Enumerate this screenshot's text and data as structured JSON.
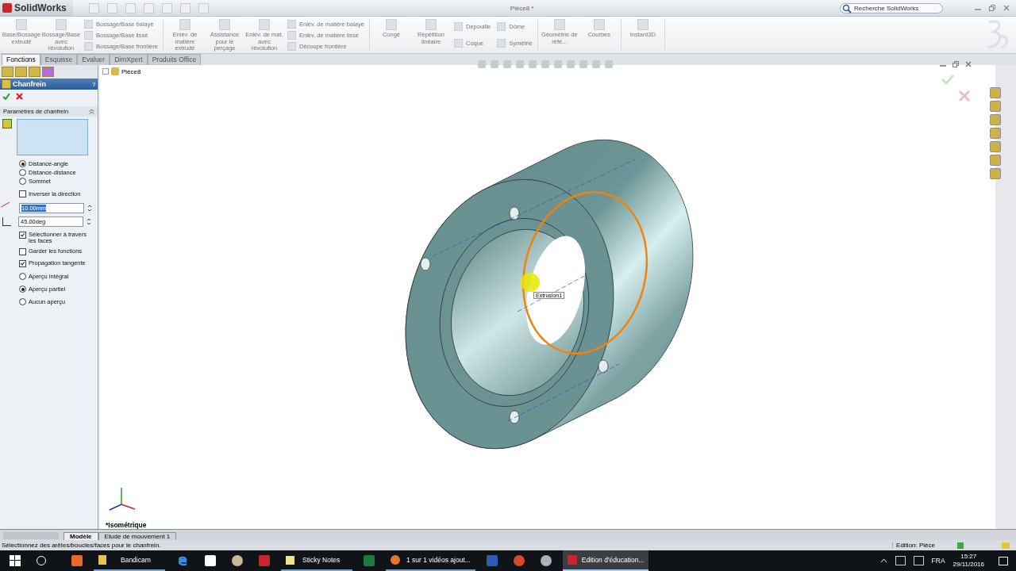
{
  "app": {
    "name": "SolidWorks",
    "document_title": "Pièce8 *",
    "search": {
      "placeholder": "Recherche SolidWorks"
    }
  },
  "ribbon": {
    "sections": [
      {
        "large": [
          "Base/Bossage extrudé",
          "Bossage/Base avec révolution"
        ],
        "columns": [
          [
            "Bossage/Base balayé",
            "Bossage/Base lissé",
            "Bossage/Base frontière"
          ]
        ]
      },
      {
        "large": [
          "Enlèv. de matière extrudé",
          "Assistance pour le perçage",
          "Enlèv. de mat. avec révolution"
        ],
        "columns": [
          [
            "Enlèv. de matière balayé",
            "Enlèv. de matière lissé",
            "Découpe frontière"
          ]
        ]
      },
      {
        "large": [
          "Congé",
          "Répétition linéaire"
        ],
        "columns": [
          [
            "Dépouille",
            "Coque"
          ],
          [
            "Dôme",
            "Symétrie"
          ]
        ]
      },
      {
        "large": [
          "Géométrie de réfé...",
          "Courbes"
        ]
      },
      {
        "large": [
          "Instant3D"
        ]
      }
    ]
  },
  "command_tabs": [
    {
      "label": "Fonctions",
      "selected": true
    },
    {
      "label": "Esquisse",
      "selected": false
    },
    {
      "label": "Evaluer",
      "selected": false
    },
    {
      "label": "DimXpert",
      "selected": false
    },
    {
      "label": "Produits Office",
      "selected": false
    }
  ],
  "property_manager": {
    "title": "Chanfrein",
    "help": "?",
    "section": "Paramètres de chanfrein",
    "types": [
      {
        "label": "Distance-angle",
        "selected": true
      },
      {
        "label": "Distance-distance",
        "selected": false
      },
      {
        "label": "Sommet",
        "selected": false
      }
    ],
    "reverse": {
      "label": "Inverser la direction",
      "checked": false
    },
    "distance": {
      "value": "10.00mm",
      "highlighted": true
    },
    "angle": {
      "value": "45.00deg",
      "highlighted": false
    },
    "options": [
      {
        "label": "Sélectionner à travers les faces",
        "checked": true
      },
      {
        "label": "Garder les fonctions",
        "checked": false
      },
      {
        "label": "Propagation tangente",
        "checked": true
      }
    ],
    "previews": [
      {
        "label": "Aperçu intégral",
        "selected": false
      },
      {
        "label": "Aperçu partiel",
        "selected": true
      },
      {
        "label": "Aucun aperçu",
        "selected": false
      }
    ]
  },
  "tree": {
    "root": "Pièce8"
  },
  "viewport": {
    "tooltip": "Extrusion1",
    "view_name": "*Isométrique"
  },
  "bottom_tabs": [
    {
      "label": "Modèle",
      "selected": true
    },
    {
      "label": "Etude de mouvement 1",
      "selected": false
    }
  ],
  "status_bar": {
    "message": "Sélectionnez des arêtes/boucles/faces pour le chanfrein.",
    "mode": "Edition: Pièce"
  },
  "taskbar": {
    "apps": [
      {
        "label": "Bandicam",
        "active": false
      },
      {
        "label": "Sticky Notes",
        "active": false
      },
      {
        "label": "1 sur 1 vidéos ajout...",
        "active": false
      },
      {
        "label": "Edition d'éducation...",
        "active": true
      }
    ],
    "language": "FRA",
    "time": "15:27",
    "date": "29/11/2016"
  }
}
